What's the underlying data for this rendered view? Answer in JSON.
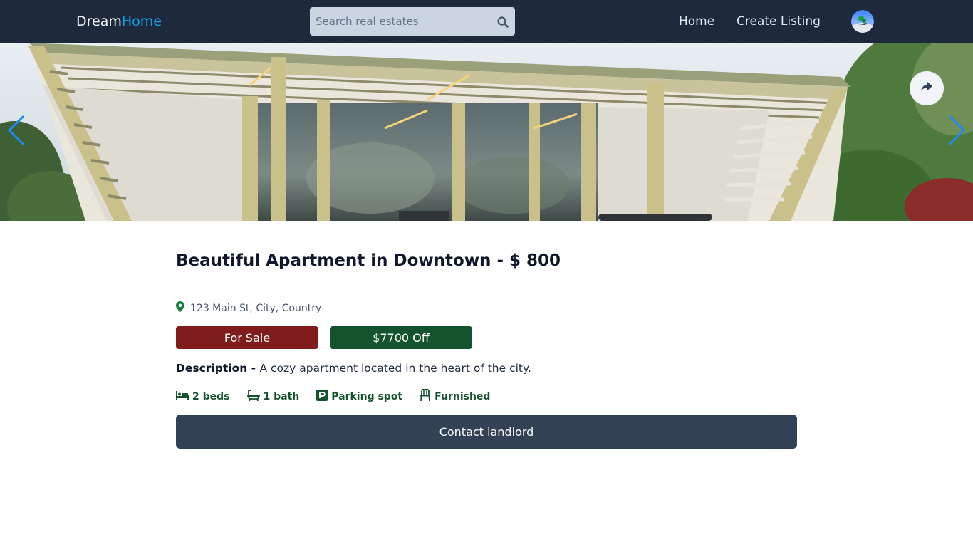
{
  "header": {
    "logo_part1": "Dream",
    "logo_part2": "Home",
    "search_placeholder": "Search real estates",
    "search_icon": "search-icon",
    "nav": {
      "home": "Home",
      "create_listing": "Create Listing"
    },
    "avatar_icon": "avatar"
  },
  "gallery": {
    "prev_icon": "chevron-left-icon",
    "next_icon": "chevron-right-icon",
    "share_icon": "share-icon"
  },
  "listing": {
    "title": "Beautiful Apartment in Downtown - $ 800",
    "address": "123 Main St, City, Country",
    "type_badge": "For Sale",
    "discount_badge": "$7700 Off",
    "description_label": "Description - ",
    "description": "A cozy apartment located in the heart of the city.",
    "features": {
      "beds": "2 beds",
      "baths": "1 bath",
      "parking": "Parking spot",
      "furnished": "Furnished"
    },
    "contact_button": "Contact landlord"
  },
  "colors": {
    "header_bg": "#1e293b",
    "logo_accent": "#0ea5e9",
    "sale_badge": "#7f1d1d",
    "discount_badge": "#14532d",
    "feature_text": "#14532d",
    "contact_button": "#334155"
  }
}
